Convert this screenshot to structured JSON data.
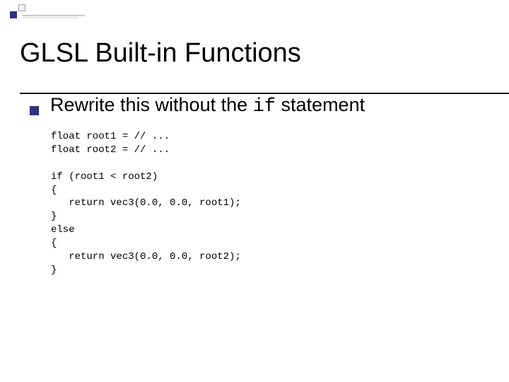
{
  "slide": {
    "title": "GLSL Built-in Functions",
    "bullet_prefix": "Rewrite this without the ",
    "bullet_code": "if",
    "bullet_suffix": " statement",
    "code": "float root1 = // ...\nfloat root2 = // ...\n\nif (root1 < root2)\n{\n   return vec3(0.0, 0.0, root1);\n}\nelse\n{\n   return vec3(0.0, 0.0, root2);\n}"
  }
}
